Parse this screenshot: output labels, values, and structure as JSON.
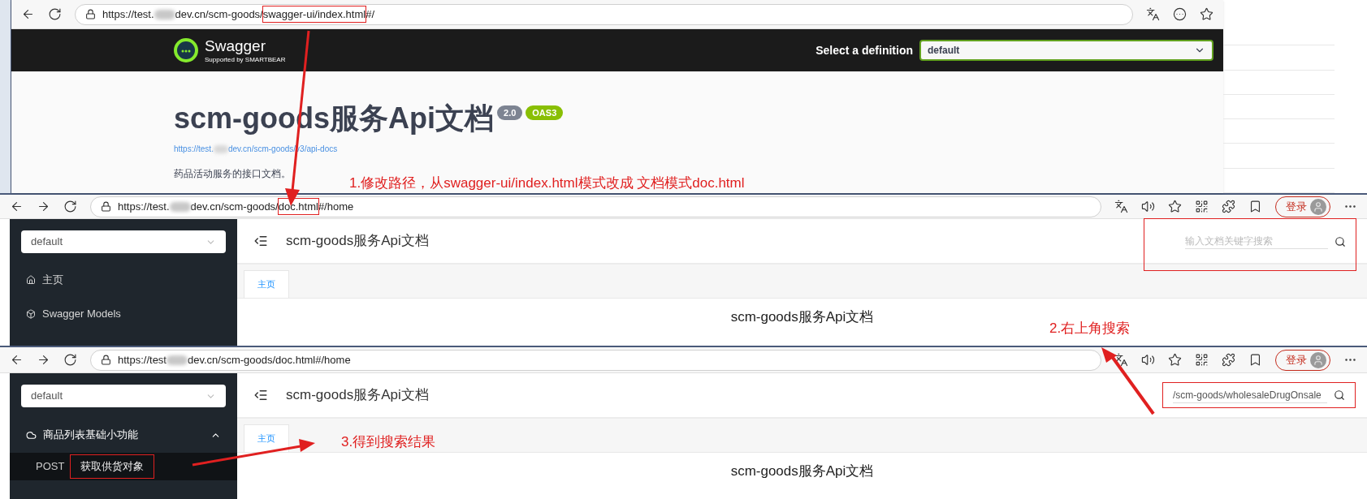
{
  "swagger_window": {
    "toolbar_left": [
      {
        "kind": "back"
      },
      {
        "kind": "refresh"
      }
    ],
    "address": [
      {
        "kind": "text",
        "text": "https://test."
      },
      {
        "kind": "redacted"
      },
      {
        "kind": "text",
        "text": "dev.cn/scm-goods/"
      },
      {
        "kind": "highlight",
        "text": "swagger-ui/index.html"
      },
      {
        "kind": "text",
        "text": "#/"
      }
    ],
    "toolbar_right": [
      {
        "kind": "translate"
      },
      {
        "kind": "more_circle"
      },
      {
        "kind": "star"
      }
    ],
    "logo": {
      "name": "Swagger",
      "tagline": "Supported by SMARTBEAR"
    },
    "definition_label": "Select a definition",
    "definition_value": "default",
    "title": "scm-goods服务Api文档",
    "badges": [
      {
        "text": "2.0",
        "color": "#7d8492"
      },
      {
        "text": "OAS3",
        "color": "#89bf04"
      }
    ],
    "spec_link": [
      {
        "kind": "text",
        "text": "https://test."
      },
      {
        "kind": "redacted"
      },
      {
        "kind": "text",
        "text": "dev.cn/scm-goods/v3/api-docs"
      }
    ],
    "description": "药品活动服务的接口文档。"
  },
  "doc_windows": [
    {
      "toolbar_left": [
        {
          "kind": "back"
        },
        {
          "kind": "forward"
        },
        {
          "kind": "refresh"
        }
      ],
      "address": [
        {
          "kind": "text",
          "text": "https://test."
        },
        {
          "kind": "redacted"
        },
        {
          "kind": "text",
          "text": "dev.cn/scm-goods/"
        },
        {
          "kind": "highlight",
          "text": "doc.html"
        },
        {
          "kind": "text",
          "text": "#/home"
        }
      ],
      "toolbar_right": [
        {
          "kind": "translate"
        },
        {
          "kind": "read_aloud"
        },
        {
          "kind": "star"
        },
        {
          "kind": "qr"
        },
        {
          "kind": "extensions"
        },
        {
          "kind": "favorites"
        },
        {
          "kind": "profile",
          "label": "登录"
        },
        {
          "kind": "more"
        }
      ],
      "group_select": "default",
      "menu": [
        {
          "kind": "home",
          "label": "主页"
        },
        {
          "kind": "models",
          "label": "Swagger Models"
        }
      ],
      "page_title": "scm-goods服务Api文档",
      "search": {
        "placeholder": "输入文档关键字搜索",
        "highlighted": true
      },
      "tabs": [
        {
          "label": "主页",
          "selected": true
        }
      ],
      "content_title": "scm-goods服务Api文档"
    },
    {
      "toolbar_left": [
        {
          "kind": "back"
        },
        {
          "kind": "forward"
        },
        {
          "kind": "refresh"
        }
      ],
      "address": [
        {
          "kind": "text",
          "text": "https://test"
        },
        {
          "kind": "redacted"
        },
        {
          "kind": "text",
          "text": "dev.cn/scm-goods/doc.html#/home"
        }
      ],
      "toolbar_right": [
        {
          "kind": "translate"
        },
        {
          "kind": "read_aloud"
        },
        {
          "kind": "star"
        },
        {
          "kind": "qr"
        },
        {
          "kind": "extensions"
        },
        {
          "kind": "favorites"
        },
        {
          "kind": "profile",
          "label": "登录"
        },
        {
          "kind": "more"
        }
      ],
      "group_select": "default",
      "menu": [
        {
          "kind": "group",
          "label": "商品列表基础小功能",
          "expanded": true,
          "children": [
            {
              "method": "POST",
              "label": "获取供货对象",
              "highlighted": true
            }
          ]
        }
      ],
      "page_title": "scm-goods服务Api文档",
      "search": {
        "value": "/scm-goods/wholesaleDrugOnsale",
        "highlighted": true
      },
      "tabs": [
        {
          "label": "主页",
          "selected": true
        }
      ],
      "content_title": "scm-goods服务Api文档"
    }
  ],
  "annotations": [
    "1.修改路径，从swagger-ui/index.html模式改成 文档模式doc.html",
    "2.右上角搜索",
    "3.得到搜索结果"
  ]
}
